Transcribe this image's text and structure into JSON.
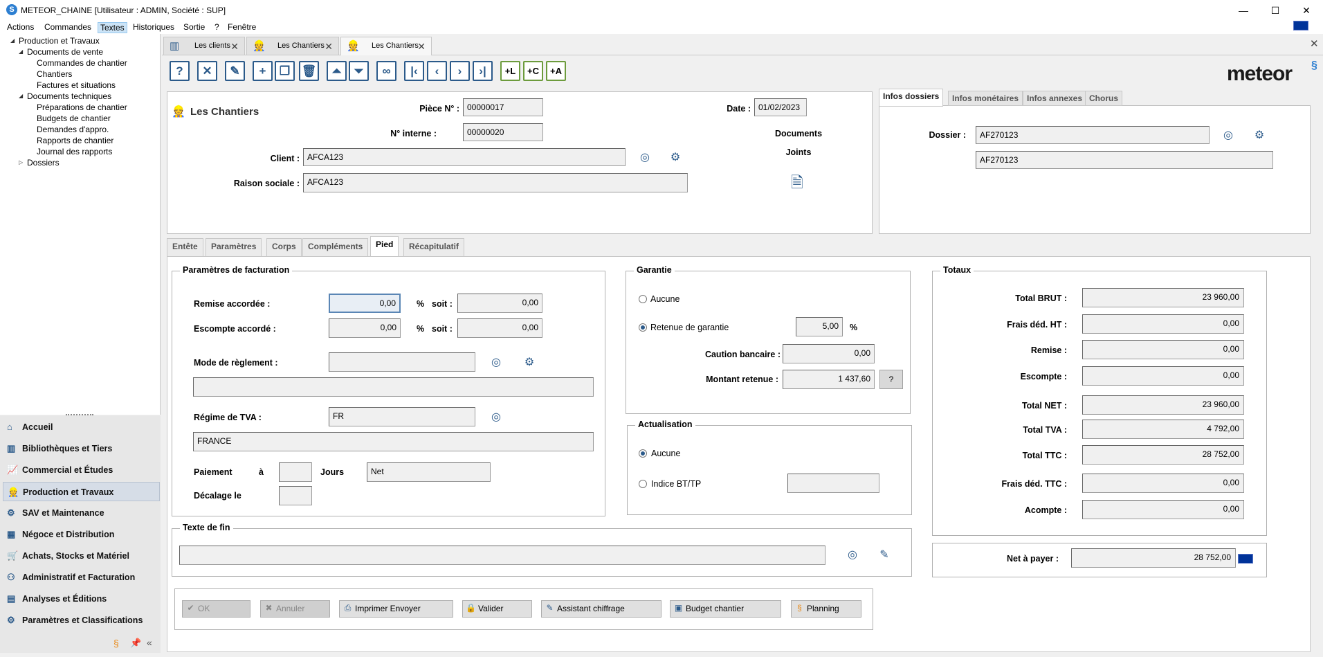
{
  "window": {
    "title": "METEOR_CHAINE [Utilisateur : ADMIN, Société : SUP]",
    "app_icon": "meteor-logo-icon"
  },
  "menu": [
    "Actions",
    "Commandes",
    "Textes",
    "Historiques",
    "Sortie",
    "?",
    "Fenêtre"
  ],
  "menu_active": "Textes",
  "tree": {
    "root": "Production et Travaux",
    "groups": [
      {
        "label": "Documents de vente",
        "items": [
          "Commandes de chantier",
          "Chantiers",
          "Factures et situations"
        ]
      },
      {
        "label": "Documents techniques",
        "items": [
          "Préparations de chantier",
          "Budgets de chantier",
          "Demandes d'appro.",
          "Rapports de chantier",
          "Journal des rapports"
        ]
      }
    ],
    "last": "Dossiers"
  },
  "sidebar": [
    "Accueil",
    "Bibliothèques et Tiers",
    "Commercial et Études",
    "Production et Travaux",
    "SAV et Maintenance",
    "Négoce et Distribution",
    "Achats, Stocks et Matériel",
    "Administratif et Facturation",
    "Analyses et Éditions",
    "Paramètres et Classifications"
  ],
  "sidebar_selected": "Production et Travaux",
  "doc_tabs": [
    "Les clients",
    "Les Chantiers",
    "Les Chantiers"
  ],
  "logo": "meteor",
  "header": {
    "title": "Les Chantiers",
    "piece_label": "Pièce N° :",
    "piece": "00000017",
    "interne_label": "N° interne :",
    "interne": "00000020",
    "date_label": "Date :",
    "date": "01/02/2023",
    "client_label": "Client :",
    "client": "AFCA123",
    "raison_label": "Raison sociale :",
    "raison": "AFCA123",
    "docs_label1": "Documents",
    "docs_label2": "Joints"
  },
  "info_tabs": [
    "Infos dossiers",
    "Infos monétaires",
    "Infos annexes",
    "Chorus"
  ],
  "dossier": {
    "label": "Dossier :",
    "code": "AF270123",
    "name": "AF270123"
  },
  "section_tabs": [
    "Entête",
    "Paramètres",
    "Corps",
    "Compléments",
    "Pied",
    "Récapitulatif"
  ],
  "section_active": "Pied",
  "facturation": {
    "title": "Paramètres de facturation",
    "remise_label": "Remise accordée :",
    "remise": "0,00",
    "remise_soit": "0,00",
    "escompte_label": "Escompte accordé :",
    "escompte": "0,00",
    "escompte_soit": "0,00",
    "pct": "%",
    "soit": "soit :",
    "mode_label": "Mode de règlement :",
    "mode": "",
    "mode_desc": "",
    "tva_label": "Régime de TVA :",
    "tva": "FR",
    "tva_desc": "FRANCE",
    "paiement_label": "Paiement",
    "a_label": "à",
    "paiement_jours": "",
    "jours_label": "Jours",
    "paiement_type": "Net",
    "decalage_label": "Décalage le",
    "decalage": ""
  },
  "garantie": {
    "title": "Garantie",
    "aucune": "Aucune",
    "retenue_label": "Retenue de garantie",
    "retenue_pct": "5,00",
    "pct": "%",
    "caution_label": "Caution bancaire :",
    "caution": "0,00",
    "montant_label": "Montant retenue :",
    "montant": "1 437,60",
    "help": "?"
  },
  "actualisation": {
    "title": "Actualisation",
    "aucune": "Aucune",
    "indice_label": "Indice BT/TP",
    "indice": ""
  },
  "texte_fin": {
    "title": "Texte de fin",
    "value": ""
  },
  "totaux": {
    "title": "Totaux",
    "rows": [
      {
        "label": "Total BRUT :",
        "value": "23 960,00"
      },
      {
        "label": "Frais déd. HT :",
        "value": "0,00"
      },
      {
        "label": "Remise :",
        "value": "0,00"
      },
      {
        "label": "Escompte :",
        "value": "0,00"
      },
      {
        "label": "Total NET :",
        "value": "23 960,00"
      },
      {
        "label": "Total TVA :",
        "value": "4 792,00"
      },
      {
        "label": "Total TTC :",
        "value": "28 752,00"
      },
      {
        "label": "Frais déd. TTC :",
        "value": "0,00"
      },
      {
        "label": "Acompte :",
        "value": "0,00"
      }
    ],
    "net_label": "Net à payer :",
    "net": "28 752,00"
  },
  "buttons": [
    "OK",
    "Annuler",
    "Imprimer Envoyer",
    "Valider",
    "Assistant chiffrage",
    "Budget chantier",
    "Planning"
  ],
  "colors": {
    "accent": "#2b5a8a",
    "selection": "#d6dde7",
    "eu_flag": "#003399"
  }
}
